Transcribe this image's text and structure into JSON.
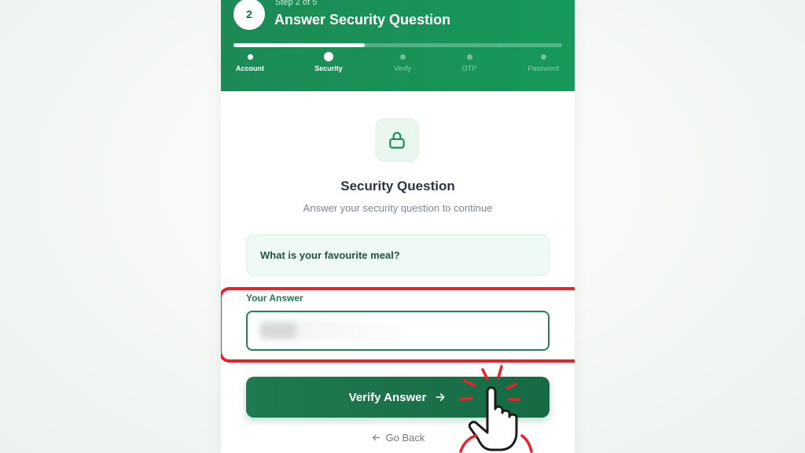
{
  "header": {
    "step_number": "2",
    "step_of": "Step 2 of 5",
    "title": "Answer Security Question",
    "progress_fraction": 0.4
  },
  "steps": [
    {
      "label": "Account",
      "state": "done"
    },
    {
      "label": "Security",
      "state": "current"
    },
    {
      "label": "Verify",
      "state": "upcoming"
    },
    {
      "label": "OTP",
      "state": "upcoming"
    },
    {
      "label": "Password",
      "state": "upcoming"
    }
  ],
  "content": {
    "icon": "lock-icon",
    "title": "Security Question",
    "subtitle": "Answer your security question to continue",
    "question": "What is your favourite meal?",
    "answer_label": "Your Answer",
    "answer_value": "",
    "verify_label": "Verify Answer",
    "verify_icon": "arrow-right-icon",
    "go_back_label": "Go Back",
    "go_back_icon": "arrow-left-icon"
  },
  "colors": {
    "primary": "#1d8a55",
    "button": "#1f7a4f",
    "highlight": "#e8212a",
    "question_bg": "#effaf4"
  }
}
